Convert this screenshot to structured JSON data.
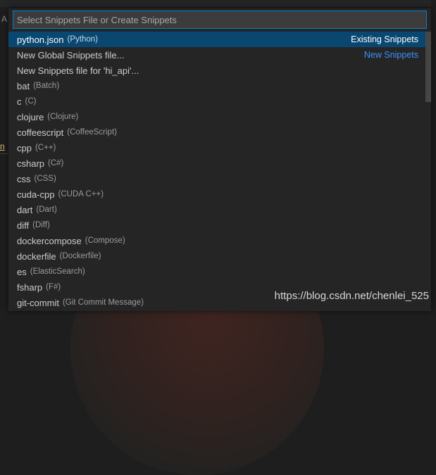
{
  "background": {
    "left_char": "A",
    "left_link_char": "n"
  },
  "quick_pick": {
    "placeholder": "Select Snippets File or Create Snippets",
    "items": [
      {
        "label": "python.json",
        "description": "(Python)",
        "badge": "Existing Snippets",
        "badge_style": "label",
        "selected": true
      },
      {
        "label": "New Global Snippets file...",
        "description": "",
        "badge": "New Snippets",
        "badge_style": "link"
      },
      {
        "label": "New Snippets file for 'hi_api'...",
        "description": ""
      },
      {
        "label": "bat",
        "description": "(Batch)"
      },
      {
        "label": "c",
        "description": "(C)"
      },
      {
        "label": "clojure",
        "description": "(Clojure)"
      },
      {
        "label": "coffeescript",
        "description": "(CoffeeScript)"
      },
      {
        "label": "cpp",
        "description": "(C++)"
      },
      {
        "label": "csharp",
        "description": "(C#)"
      },
      {
        "label": "css",
        "description": "(CSS)"
      },
      {
        "label": "cuda-cpp",
        "description": "(CUDA C++)"
      },
      {
        "label": "dart",
        "description": "(Dart)"
      },
      {
        "label": "diff",
        "description": "(Diff)"
      },
      {
        "label": "dockercompose",
        "description": "(Compose)"
      },
      {
        "label": "dockerfile",
        "description": "(Dockerfile)"
      },
      {
        "label": "es",
        "description": "(ElasticSearch)"
      },
      {
        "label": "fsharp",
        "description": "(F#)"
      },
      {
        "label": "git-commit",
        "description": "(Git Commit Message)"
      }
    ]
  },
  "watermark": "https://blog.csdn.net/chenlei_525",
  "colors": {
    "selection": "#094771",
    "focus_border": "#007fd4",
    "link": "#3794ff",
    "panel": "#252526"
  }
}
